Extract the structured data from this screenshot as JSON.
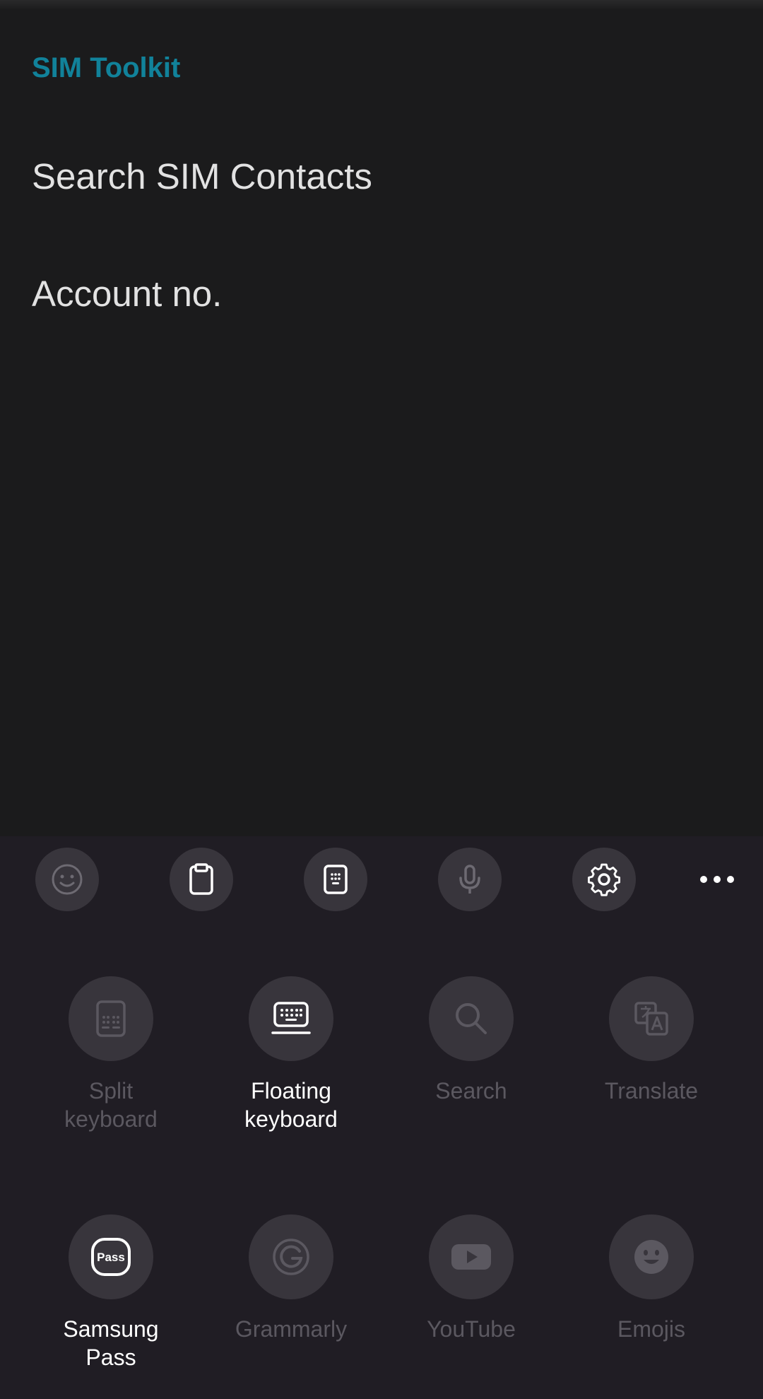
{
  "screen": {
    "app_title": "SIM Toolkit",
    "menu_items": [
      {
        "label": "Search SIM Contacts"
      },
      {
        "label": "Account no."
      }
    ]
  },
  "keyboard_toolbar": {
    "buttons": [
      {
        "icon": "emoji-icon"
      },
      {
        "icon": "clipboard-icon"
      },
      {
        "icon": "keyboard-mode-icon"
      },
      {
        "icon": "microphone-icon"
      },
      {
        "icon": "settings-gear-icon"
      },
      {
        "icon": "more-options-icon"
      }
    ]
  },
  "keyboard_tiles": [
    {
      "label": "Split\nkeyboard",
      "icon": "split-keyboard-icon",
      "active": false
    },
    {
      "label": "Floating\nkeyboard",
      "icon": "floating-keyboard-icon",
      "active": true
    },
    {
      "label": "Search",
      "icon": "search-icon",
      "active": false
    },
    {
      "label": "Translate",
      "icon": "translate-icon",
      "active": false
    },
    {
      "label": "Samsung\nPass",
      "icon": "samsung-pass-icon",
      "active": true
    },
    {
      "label": "Grammarly",
      "icon": "grammarly-icon",
      "active": false
    },
    {
      "label": "YouTube",
      "icon": "youtube-icon",
      "active": false
    },
    {
      "label": "Emojis",
      "icon": "emojis-icon",
      "active": false
    }
  ],
  "colors": {
    "background": "#1b1b1c",
    "accent": "#11829a",
    "panel": "#201d24",
    "button": "#38353c",
    "disabled_text": "#5b5860"
  }
}
